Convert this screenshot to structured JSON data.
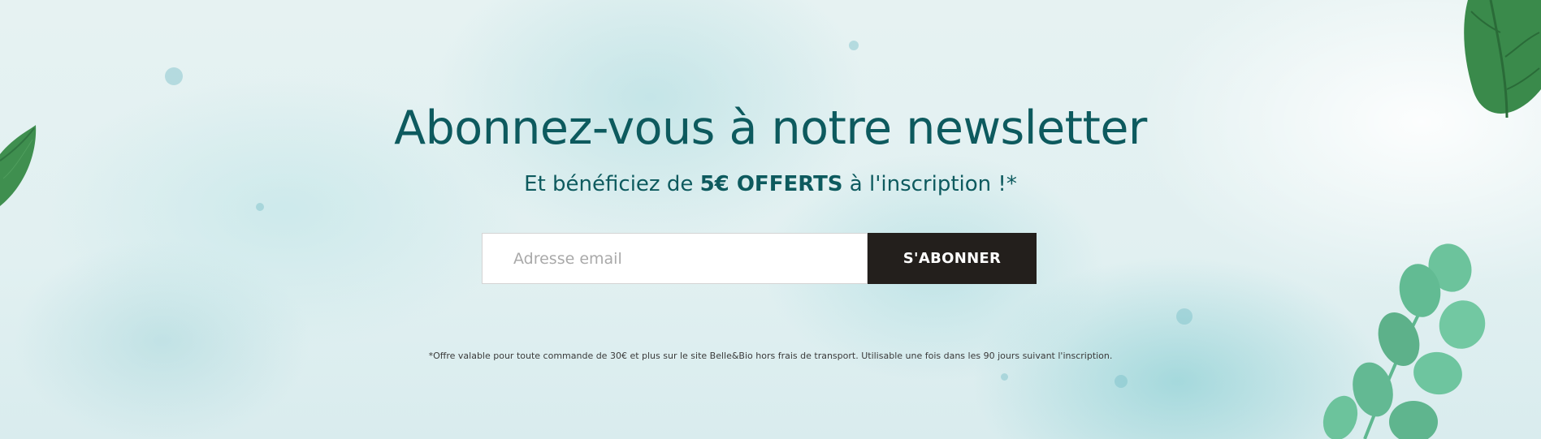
{
  "newsletter": {
    "title": "Abonnez-vous à notre newsletter",
    "subtitle_before": "Et bénéficiez de ",
    "subtitle_highlight": "5€ OFFERTS",
    "subtitle_after": " à l'inscription !*",
    "email_placeholder": "Adresse email",
    "email_value": "",
    "subscribe_label": "S'ABONNER",
    "disclaimer": "*Offre valable pour toute commande de 30€ et plus sur le site Belle&Bio hors frais de transport. Utilisable une fois dans les 90 jours suivant l'inscription."
  },
  "colors": {
    "heading": "#0d5a5e",
    "button_bg": "#231f1c",
    "button_text": "#ffffff",
    "leaf_dark": "#3f8f4f",
    "leaf_light": "#7cc7a0"
  },
  "decorations": [
    "leaf-left-icon",
    "leaf-top-right-icon",
    "eucalyptus-branch-icon"
  ]
}
